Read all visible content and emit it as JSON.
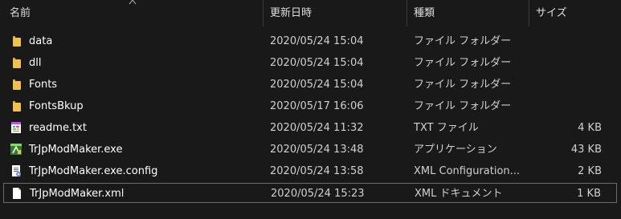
{
  "header": {
    "name": "名前",
    "date": "更新日時",
    "type": "種類",
    "size": "サイズ"
  },
  "colors": {
    "background": "#191919",
    "folder": "#f1c24b",
    "text": "#ffffff",
    "subtext": "#d0d0d0",
    "selection_border": "#6b6b6b"
  },
  "files": [
    {
      "name": "data",
      "date": "2020/05/24 15:04",
      "type": "ファイル フォルダー",
      "size": "",
      "icon": "folder-icon"
    },
    {
      "name": "dll",
      "date": "2020/05/24 15:04",
      "type": "ファイル フォルダー",
      "size": "",
      "icon": "folder-icon"
    },
    {
      "name": "Fonts",
      "date": "2020/05/24 15:04",
      "type": "ファイル フォルダー",
      "size": "",
      "icon": "folder-icon"
    },
    {
      "name": "FontsBkup",
      "date": "2020/05/17 16:06",
      "type": "ファイル フォルダー",
      "size": "",
      "icon": "folder-icon"
    },
    {
      "name": "readme.txt",
      "date": "2020/05/24 11:32",
      "type": "TXT ファイル",
      "size": "4 KB",
      "icon": "text-file-icon"
    },
    {
      "name": "TrJpModMaker.exe",
      "date": "2020/05/24 13:48",
      "type": "アプリケーション",
      "size": "43 KB",
      "icon": "application-icon"
    },
    {
      "name": "TrJpModMaker.exe.config",
      "date": "2020/05/24 13:58",
      "type": "XML Configuration...",
      "size": "2 KB",
      "icon": "config-file-icon"
    },
    {
      "name": "TrJpModMaker.xml",
      "date": "2020/05/24 15:23",
      "type": "XML ドキュメント",
      "size": "1 KB",
      "icon": "xml-file-icon",
      "selected": true
    }
  ]
}
